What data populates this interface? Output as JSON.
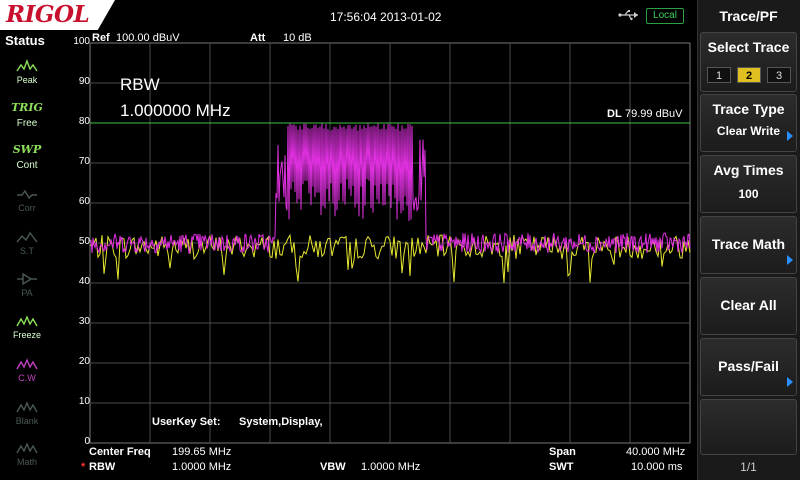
{
  "brand": {
    "logo": "RIGOL"
  },
  "header": {
    "datetime": "17:56:04 2013-01-02",
    "remote_badge": "Local"
  },
  "status": {
    "title": "Status",
    "items": [
      {
        "icon": "peak-icon",
        "label": "Peak",
        "state": "on"
      },
      {
        "icon_text": "TRIG",
        "label": "Free",
        "state": "on"
      },
      {
        "icon_text": "SWP",
        "label": "Cont",
        "state": "on"
      },
      {
        "icon": "corr-icon",
        "label": "Corr",
        "state": "off"
      },
      {
        "icon": "st-icon",
        "label": "S.T",
        "state": "off"
      },
      {
        "icon": "pa-icon",
        "label": "PA",
        "state": "off"
      },
      {
        "icon": "freeze-icon",
        "label": "Freeze",
        "state": "on"
      },
      {
        "icon": "clear-write-icon",
        "label": "C.W",
        "state": "trace"
      },
      {
        "icon": "blank-icon",
        "label": "Blank",
        "state": "off"
      },
      {
        "icon": "math-icon",
        "label": "Math",
        "state": "off"
      }
    ]
  },
  "display": {
    "ref_label": "Ref",
    "ref_value": "100.00 dBuV",
    "att_label": "Att",
    "att_value": "10 dB",
    "rbw_title": "RBW",
    "rbw_readout": "1.000000 MHz",
    "display_line_label": "DL",
    "display_line_value": "79.99 dBuV",
    "userkey_label": "UserKey Set:",
    "userkey_value": "System,Display,",
    "center_freq_label": "Center Freq",
    "center_freq_value": "199.65 MHz",
    "rbw_label": "RBW",
    "rbw_flag": "*",
    "rbw_value": "1.0000 MHz",
    "vbw_label": "VBW",
    "vbw_value": "1.0000 MHz",
    "span_label": "Span",
    "span_value": "40.000 MHz",
    "swt_label": "SWT",
    "swt_value": "10.000 ms"
  },
  "y_ticks": [
    "100",
    "90",
    "80",
    "70",
    "60",
    "50",
    "40",
    "30",
    "20",
    "10",
    "0"
  ],
  "chart_data": {
    "type": "line",
    "ylim": [
      0,
      100
    ],
    "xlim": [
      179.65,
      219.65
    ],
    "grid": true,
    "display_line": 79.99,
    "series": [
      {
        "color": "#e030e0",
        "noise_floor": 50,
        "band": [
          192.0,
          202.0
        ],
        "band_level": 80
      },
      {
        "color": "#e8e830",
        "noise_floor": 49
      }
    ]
  },
  "menu": {
    "title": "Trace/PF",
    "select_trace_label": "Select Trace",
    "traces": [
      "1",
      "2",
      "3"
    ],
    "selected_trace": "2",
    "trace_type_label": "Trace Type",
    "trace_type_value": "Clear Write",
    "avg_times_label": "Avg Times",
    "avg_times_value": "100",
    "trace_math_label": "Trace Math",
    "clear_all_label": "Clear All",
    "pass_fail_label": "Pass/Fail",
    "page_indicator": "1/1"
  },
  "colors": {
    "trace_main": "#e030e0",
    "trace_secondary": "#e8e830",
    "display_line": "#40c040",
    "accent": "#e0c020"
  }
}
